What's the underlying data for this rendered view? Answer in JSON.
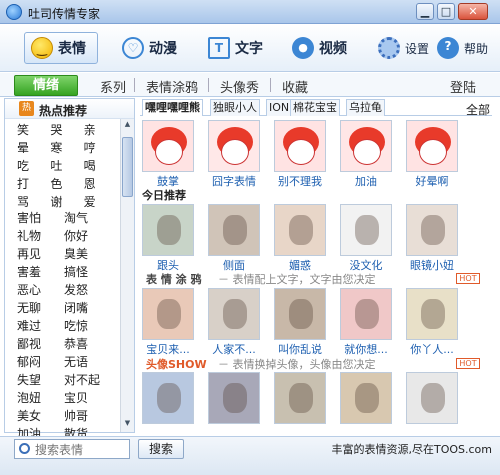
{
  "window": {
    "title": "吐司传情专家",
    "minimize": "▁",
    "maximize": "□",
    "close": "✕"
  },
  "toolbar": [
    {
      "label": "表情",
      "icon": "smiley-icon",
      "active": true
    },
    {
      "label": "动漫",
      "icon": "heart-icon",
      "active": false
    },
    {
      "label": "文字",
      "icon": "text-icon",
      "active": false
    },
    {
      "label": "视频",
      "icon": "video-icon",
      "active": false
    }
  ],
  "toolbar_small": {
    "settings": "设置",
    "help": "帮助"
  },
  "category_bar": {
    "active": "情绪",
    "items": [
      "系列",
      "表情涂鸦",
      "头像秀",
      "收藏"
    ],
    "login": "登陆"
  },
  "sidebar": {
    "hot_badge": "热",
    "title": "热点推荐",
    "words3": [
      "笑",
      "哭",
      "亲",
      "晕",
      "寒",
      "哼",
      "吃",
      "吐",
      "喝",
      "打",
      "色",
      "恩",
      "骂",
      "谢",
      "爱"
    ],
    "words2": [
      "害怕",
      "淘气",
      "礼物",
      "你好",
      "再见",
      "臭美",
      "害羞",
      "搞怪",
      "恶心",
      "发怒",
      "无聊",
      "闭嘴",
      "难过",
      "吃惊",
      "鄙视",
      "恭喜",
      "郁闷",
      "无语",
      "失望",
      "对不起",
      "泡妞",
      "宝贝",
      "美女",
      "帅哥",
      "加油",
      "散货"
    ]
  },
  "subtabs": {
    "items": [
      "嘿哩嘿哩熊",
      "独眼小人",
      "ION",
      "棉花宝宝",
      "乌拉龟"
    ],
    "all": "全部"
  },
  "row1": [
    "鼓掌",
    "囧字表情",
    "别不理我",
    "加油",
    "好晕啊"
  ],
  "section_today": {
    "title": "今日推荐"
  },
  "row2": [
    "跟头",
    "侧面",
    "媚惑",
    "没文化",
    "眼镜小妞"
  ],
  "section_doodle": {
    "title": "表 情 涂 鸦",
    "desc": "－ 表情配上文字，文字由您决定",
    "tag": "HOT"
  },
  "row3": [
    "宝贝来...",
    "人家不...",
    "叫你乱说",
    "就你想...",
    "你丫人..."
  ],
  "section_avatar": {
    "title": "头像SHOW",
    "desc": "－ 表情换掉头像，头像由您决定",
    "tag": "HOT"
  },
  "search": {
    "placeholder": "搜索表情",
    "button": "搜索"
  },
  "footer": {
    "text": "丰富的表情资源,尽在TOOS.com"
  },
  "colors": {
    "accent": "#3c86d4",
    "active_green": "#35a322",
    "hot_orange": "#e8871d",
    "link_blue": "#1d5fb0"
  }
}
